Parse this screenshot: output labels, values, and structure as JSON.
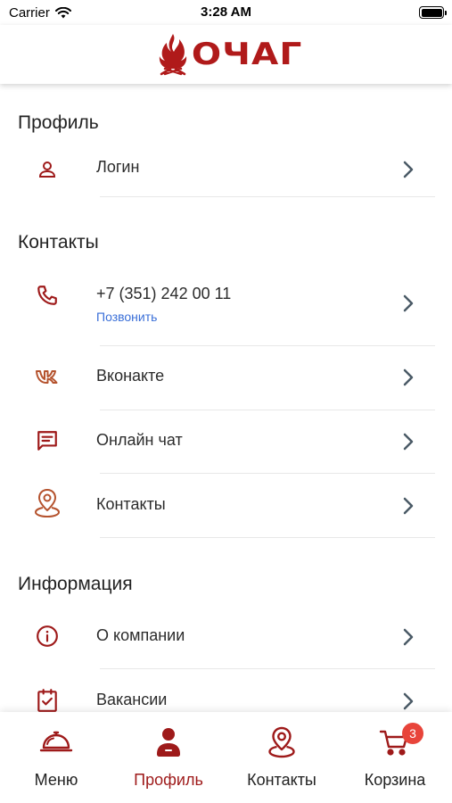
{
  "status_bar": {
    "carrier": "Carrier",
    "time": "3:28 AM"
  },
  "header": {
    "logo_text": "ОЧАГ"
  },
  "colors": {
    "brand": "#9e1a1a",
    "icon_brown": "#b5532e",
    "link": "#3a6fd8",
    "chevron": "#4a5a66",
    "badge": "#e8443a"
  },
  "profile": {
    "title": "Профиль",
    "items": [
      {
        "label": "Логин",
        "icon": "user-icon"
      }
    ]
  },
  "contacts": {
    "title": "Контакты",
    "items": [
      {
        "label": "+7 (351) 242 00 11",
        "sub": "Позвонить",
        "icon": "phone-icon"
      },
      {
        "label": "Вконакте",
        "icon": "vk-icon"
      },
      {
        "label": "Онлайн чат",
        "icon": "chat-icon"
      },
      {
        "label": "Контакты",
        "icon": "location-pin-icon"
      }
    ]
  },
  "info": {
    "title": "Информация",
    "items": [
      {
        "label": "О компании",
        "icon": "info-icon"
      },
      {
        "label": "Вакансии",
        "icon": "clipboard-check-icon"
      }
    ]
  },
  "tabs": [
    {
      "label": "Меню",
      "icon": "cloche-icon",
      "active": false
    },
    {
      "label": "Профиль",
      "icon": "profile-icon",
      "active": true
    },
    {
      "label": "Контакты",
      "icon": "map-pin-icon",
      "active": false
    },
    {
      "label": "Корзина",
      "icon": "cart-icon",
      "active": false,
      "badge": "3"
    }
  ]
}
